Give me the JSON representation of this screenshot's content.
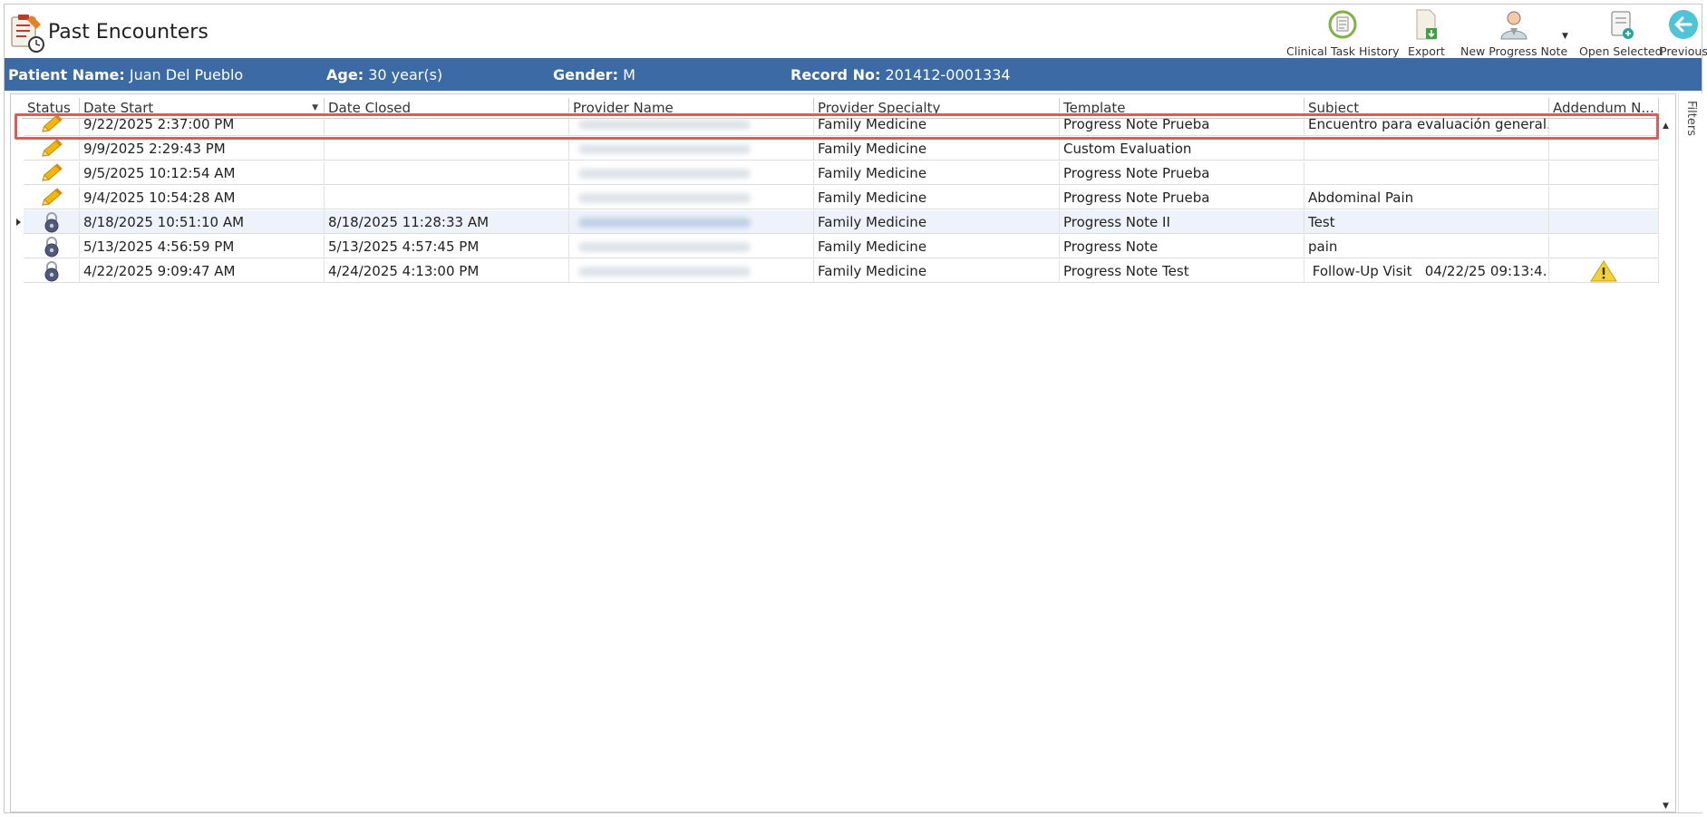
{
  "window": {
    "title": "Past Encounters"
  },
  "toolbar": {
    "clinical_task_history": "Clinical Task History",
    "export": "Export",
    "new_progress_note": "New Progress Note",
    "open_selected": "Open Selected",
    "previous": "Previous"
  },
  "patient": {
    "name_label": "Patient Name:",
    "name": "Juan Del Pueblo",
    "age_label": "Age:",
    "age": "30 year(s)",
    "gender_label": "Gender:",
    "gender": "M",
    "record_label": "Record No:",
    "record": "201412-0001334"
  },
  "grid": {
    "columns": [
      "Status",
      "Date Start",
      "Date Closed",
      "Provider Name",
      "Provider Specialty",
      "Template",
      "Subject",
      "Addendum N..."
    ],
    "filters_label": "Filters",
    "rows": [
      {
        "status": "pencil-icon",
        "date_start": "9/22/2025 2:37:00 PM",
        "date_closed": "",
        "specialty": "Family Medicine",
        "template": "Progress Note Prueba",
        "subject": "Encuentro para evaluación general.",
        "addendum": ""
      },
      {
        "status": "pencil-icon",
        "date_start": "9/9/2025 2:29:43 PM",
        "date_closed": "",
        "specialty": "Family Medicine",
        "template": "Custom Evaluation",
        "subject": "",
        "addendum": ""
      },
      {
        "status": "pencil-icon",
        "date_start": "9/5/2025 10:12:54 AM",
        "date_closed": "",
        "specialty": "Family Medicine",
        "template": "Progress Note Prueba",
        "subject": "",
        "addendum": ""
      },
      {
        "status": "pencil-icon",
        "date_start": "9/4/2025 10:54:28 AM",
        "date_closed": "",
        "specialty": "Family Medicine",
        "template": "Progress Note Prueba",
        "subject": "Abdominal Pain",
        "addendum": ""
      },
      {
        "status": "lock-icon",
        "date_start": "8/18/2025 10:51:10 AM",
        "date_closed": "8/18/2025 11:28:33 AM",
        "specialty": "Family Medicine",
        "template": "Progress Note II",
        "subject": "Test",
        "addendum": ""
      },
      {
        "status": "lock-icon",
        "date_start": "5/13/2025 4:56:59 PM",
        "date_closed": "5/13/2025 4:57:45 PM",
        "specialty": "Family Medicine",
        "template": "Progress Note",
        "subject": "pain",
        "addendum": ""
      },
      {
        "status": "lock-icon",
        "date_start": "4/22/2025 9:09:47 AM",
        "date_closed": "4/24/2025 4:13:00 PM",
        "specialty": "Family Medicine",
        "template": "Progress Note Test",
        "subject": " Follow-Up Visit   04/22/25 09:13:4...",
        "addendum": "warning-icon"
      }
    ]
  },
  "colors": {
    "header_bar": "#3b6aa5",
    "selection_frame": "#e05a5a",
    "current_row": "#eef3fb"
  }
}
